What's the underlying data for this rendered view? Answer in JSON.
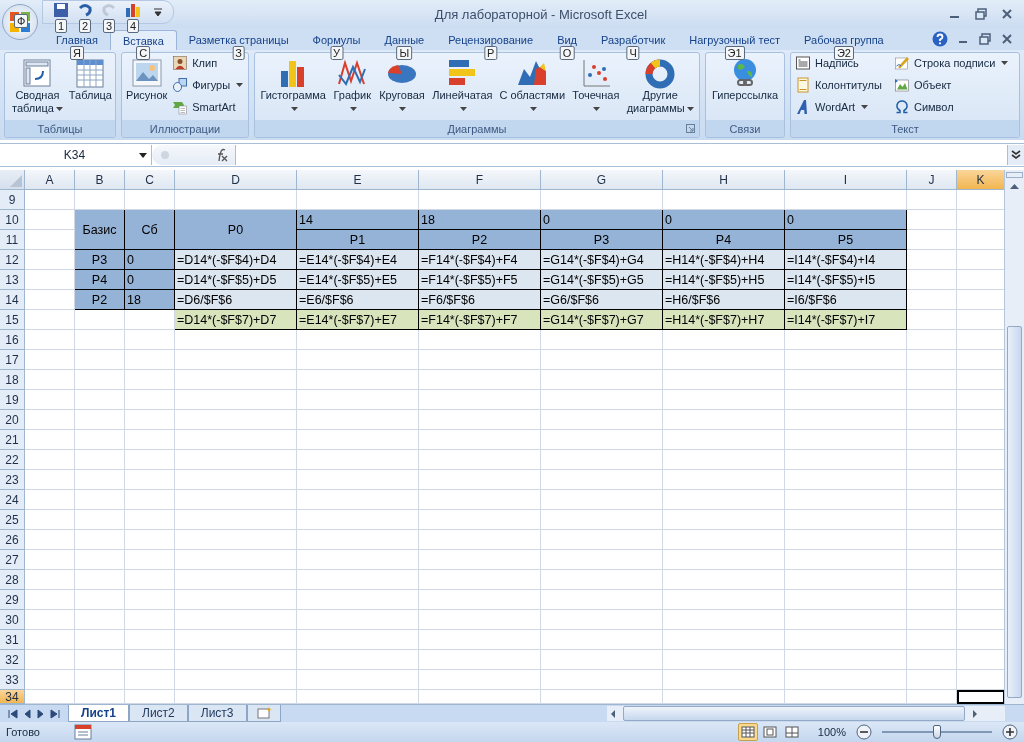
{
  "window": {
    "title": "Для лабораторной - Microsoft Excel",
    "office_keytip": "Ф"
  },
  "quick_access": [
    {
      "keytip": "1",
      "disabled": false
    },
    {
      "keytip": "2",
      "disabled": false
    },
    {
      "keytip": "3",
      "disabled": true
    },
    {
      "keytip": "4",
      "disabled": false
    }
  ],
  "tabs": [
    {
      "label": "Главная",
      "keytip": "Я",
      "selected": false
    },
    {
      "label": "Вставка",
      "keytip": "С",
      "selected": true
    },
    {
      "label": "Разметка страницы",
      "keytip": "З",
      "selected": false
    },
    {
      "label": "Формулы",
      "keytip": "У",
      "selected": false
    },
    {
      "label": "Данные",
      "keytip": "Ы",
      "selected": false
    },
    {
      "label": "Рецензирование",
      "keytip": "Р",
      "selected": false
    },
    {
      "label": "Вид",
      "keytip": "О",
      "selected": false
    },
    {
      "label": "Разработчик",
      "keytip": "Ч",
      "selected": false
    },
    {
      "label": "Нагрузочный тест",
      "keytip": "Э1",
      "selected": false
    },
    {
      "label": "Рабочая группа",
      "keytip": "Э2",
      "selected": false
    }
  ],
  "ribbon": {
    "groups": [
      {
        "title": "Таблицы",
        "buttons": [
          {
            "kind": "large",
            "label": "Сводная таблица",
            "dropdown": true
          },
          {
            "kind": "large",
            "label": "Таблица",
            "dropdown": false
          }
        ]
      },
      {
        "title": "Иллюстрации",
        "buttons": [
          {
            "kind": "large",
            "label": "Рисунок",
            "dropdown": false
          },
          {
            "kind": "small",
            "label": "Клип",
            "dropdown": false
          },
          {
            "kind": "small",
            "label": "Фигуры",
            "dropdown": true
          },
          {
            "kind": "small",
            "label": "SmartArt",
            "dropdown": false
          }
        ]
      },
      {
        "title": "Диаграммы",
        "launcher": true,
        "buttons": [
          {
            "kind": "large",
            "label": "Гистограмма",
            "dropdown": true
          },
          {
            "kind": "large",
            "label": "График",
            "dropdown": true
          },
          {
            "kind": "large",
            "label": "Круговая",
            "dropdown": true
          },
          {
            "kind": "large",
            "label": "Линейчатая",
            "dropdown": true
          },
          {
            "kind": "large",
            "label": "С областями",
            "dropdown": true
          },
          {
            "kind": "large",
            "label": "Точечная",
            "dropdown": true
          },
          {
            "kind": "large",
            "label": "Другие диаграммы",
            "dropdown": true
          }
        ]
      },
      {
        "title": "Связи",
        "buttons": [
          {
            "kind": "large",
            "label": "Гиперссылка",
            "dropdown": false
          }
        ]
      },
      {
        "title": "Текст",
        "buttons": [
          {
            "kind": "small",
            "label": "Надпись",
            "dropdown": false
          },
          {
            "kind": "small",
            "label": "Колонтитулы",
            "dropdown": false
          },
          {
            "kind": "small",
            "label": "WordArt",
            "dropdown": true
          },
          {
            "kind": "small",
            "label": "Строка подписи",
            "dropdown": true
          },
          {
            "kind": "small",
            "label": "Объект",
            "dropdown": false
          },
          {
            "kind": "small",
            "label": "Символ",
            "dropdown": false
          }
        ]
      }
    ]
  },
  "formula_bar": {
    "name_box": "K34"
  },
  "columns": [
    {
      "label": "A",
      "selected": false
    },
    {
      "label": "B",
      "selected": false
    },
    {
      "label": "C",
      "selected": false
    },
    {
      "label": "D",
      "selected": false
    },
    {
      "label": "E",
      "selected": false
    },
    {
      "label": "F",
      "selected": false
    },
    {
      "label": "G",
      "selected": false
    },
    {
      "label": "H",
      "selected": false
    },
    {
      "label": "I",
      "selected": false
    },
    {
      "label": "J",
      "selected": false
    },
    {
      "label": "K",
      "selected": true
    }
  ],
  "rows": [
    {
      "label": "9",
      "selected": false
    },
    {
      "label": "10",
      "selected": false
    },
    {
      "label": "11",
      "selected": false
    },
    {
      "label": "12",
      "selected": false
    },
    {
      "label": "13",
      "selected": false
    },
    {
      "label": "14",
      "selected": false
    },
    {
      "label": "15",
      "selected": false
    },
    {
      "label": "16",
      "selected": false
    },
    {
      "label": "17",
      "selected": false
    },
    {
      "label": "18",
      "selected": false
    },
    {
      "label": "19",
      "selected": false
    },
    {
      "label": "20",
      "selected": false
    },
    {
      "label": "21",
      "selected": false
    },
    {
      "label": "22",
      "selected": false
    },
    {
      "label": "23",
      "selected": false
    },
    {
      "label": "24",
      "selected": false
    },
    {
      "label": "25",
      "selected": false
    },
    {
      "label": "26",
      "selected": false
    },
    {
      "label": "27",
      "selected": false
    },
    {
      "label": "28",
      "selected": false
    },
    {
      "label": "29",
      "selected": false
    },
    {
      "label": "30",
      "selected": false
    },
    {
      "label": "31",
      "selected": false
    },
    {
      "label": "32",
      "selected": false
    },
    {
      "label": "33",
      "selected": false
    },
    {
      "label": "34",
      "selected": true
    }
  ],
  "table": {
    "corner_headers": [
      "Базис",
      "Сб",
      "P0"
    ],
    "costs": [
      "14",
      "18",
      "0",
      "0",
      "0"
    ],
    "vectors": [
      "P1",
      "P2",
      "P3",
      "P4",
      "P5"
    ],
    "rows": [
      {
        "basis": "P3",
        "cb": "0",
        "values": [
          "=D14*(-$F$4)+D4",
          "=E14*(-$F$4)+E4",
          "=F14*(-$F$4)+F4",
          "=G14*(-$F$4)+G4",
          "=H14*(-$F$4)+H4",
          "=I14*(-$F$4)+I4"
        ]
      },
      {
        "basis": "P4",
        "cb": "0",
        "values": [
          "=D14*(-$F$5)+D5",
          "=E14*(-$F$5)+E5",
          "=F14*(-$F$5)+F5",
          "=G14*(-$F$5)+G5",
          "=H14*(-$F$5)+H5",
          "=I14*(-$F$5)+I5"
        ]
      },
      {
        "basis": "P2",
        "cb": "18",
        "values": [
          "=D6/$F$6",
          "=E6/$F$6",
          "=F6/$F$6",
          "=G6/$F$6",
          "=H6/$F$6",
          "=I6/$F$6"
        ]
      }
    ],
    "total_row": [
      "=D14*(-$F$7)+D7",
      "=E14*(-$F$7)+E7",
      "=F14*(-$F$7)+F7",
      "=G14*(-$F$7)+G7",
      "=H14*(-$F$7)+H7",
      "=I14*(-$F$7)+I7"
    ]
  },
  "sheet_tabs": [
    {
      "label": "Лист1",
      "selected": true
    },
    {
      "label": "Лист2",
      "selected": false
    },
    {
      "label": "Лист3",
      "selected": false
    }
  ],
  "status_bar": {
    "text": "Готово",
    "zoom": "100%",
    "zoom_slider": {
      "level": 0.5
    }
  }
}
